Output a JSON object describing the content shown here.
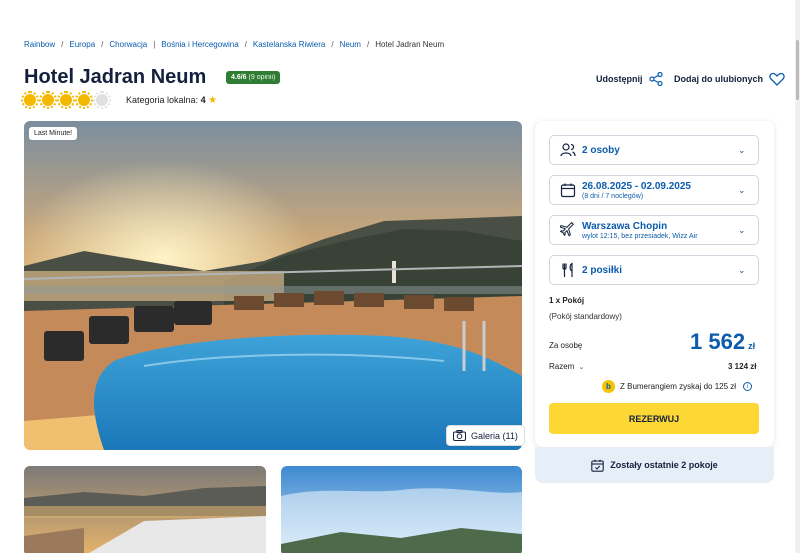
{
  "breadcrumb": {
    "items": [
      "Rainbow",
      "Europa",
      "Chorwacja",
      "Bośnia i Hercegowina",
      "Kastelanska Riwiera",
      "Neum"
    ],
    "current": "Hotel Jadran Neum"
  },
  "hotel": {
    "name": "Hotel Jadran Neum",
    "rating": "4.6/6",
    "reviews": "(9 opinii)",
    "suns_filled": 4,
    "suns_total": 5,
    "category_label": "Kategoria lokalna:",
    "category_value": "4",
    "category_icon": "star-icon"
  },
  "actions": {
    "share_label": "Udostępnij",
    "share_icon": "share-icon",
    "favorite_label": "Dodaj do ulubionych",
    "favorite_icon": "heart-icon"
  },
  "gallery": {
    "badge": "Last Minute!",
    "button_label": "Galeria (11)",
    "button_icon": "camera-icon"
  },
  "booking": {
    "persons": {
      "label": "2 osoby",
      "icon": "people-icon"
    },
    "dates": {
      "label": "26.08.2025 - 02.09.2025",
      "sub": "(8 dni / 7 noclegów)",
      "icon": "calendar-icon"
    },
    "flight": {
      "label": "Warszawa Chopin",
      "sub": "wylot 12:15, bez przesiadek, Wizz Air",
      "icon": "plane-icon"
    },
    "meals": {
      "label": "2 posiłki",
      "icon": "cutlery-icon"
    },
    "room_count": "1 x Pokój",
    "room_type": "(Pokój standardowy)",
    "per_person_label": "Za osobę",
    "price": "1 562",
    "currency": "zł",
    "total_label": "Razem",
    "total": "3 124 zł",
    "bumerang_text": "Z Bumerangiem zyskaj do 125 zł",
    "bumerang_icon": "b",
    "reserve_label": "REZERWUJ",
    "rooms_left": "Zostały ostatnie 2 pokoje",
    "rooms_left_icon": "calendar-check-icon"
  },
  "colors": {
    "brand_blue": "#0b5cad",
    "accent_yellow": "#fdd835",
    "rating_green": "#2e7d32"
  }
}
